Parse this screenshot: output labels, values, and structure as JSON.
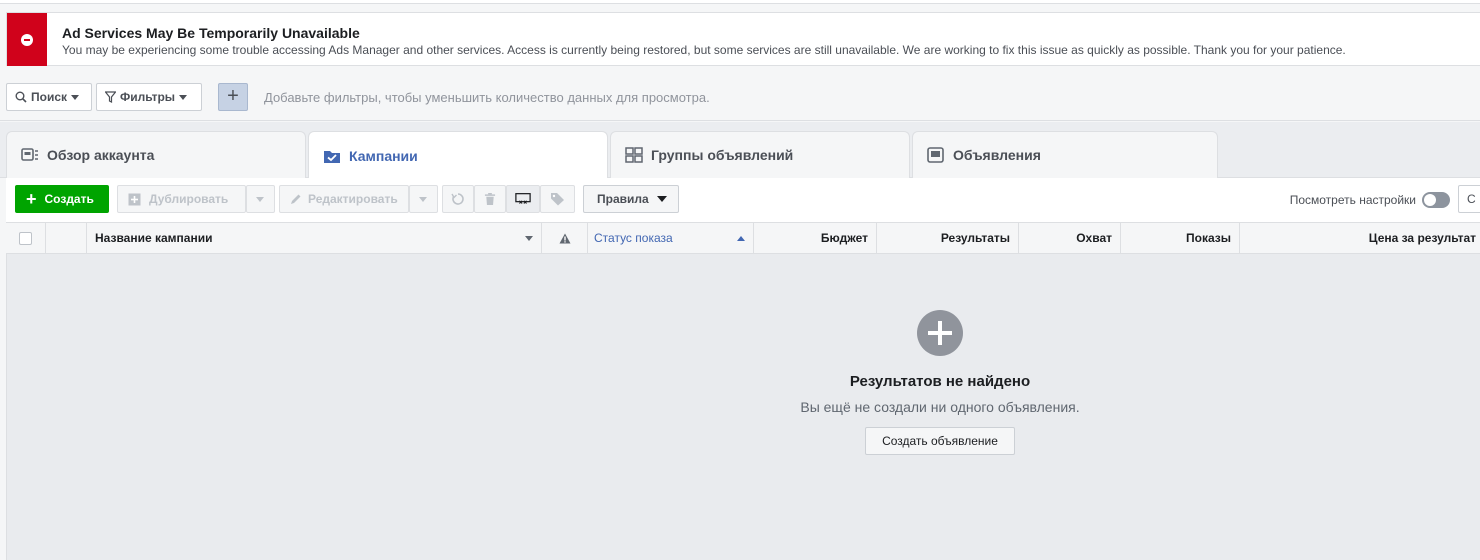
{
  "alert": {
    "title": "Ad Services May Be Temporarily Unavailable",
    "message": "You may be experiencing some trouble accessing Ads Manager and other services. Access is currently being restored, but some services are still unavailable. We are working to fix this issue as quickly as possible. Thank you for your patience.",
    "accent": "#d0021b"
  },
  "filters": {
    "search_label": "Поиск",
    "filters_label": "Фильтры",
    "add_label": "+",
    "hint": "Добавьте фильтры, чтобы уменьшить количество данных для просмотра."
  },
  "tabs": [
    {
      "label": "Обзор аккаунта",
      "icon": "account-overview-icon",
      "active": false
    },
    {
      "label": "Кампании",
      "icon": "folder-check-icon",
      "active": true
    },
    {
      "label": "Группы объявлений",
      "icon": "grid-icon",
      "active": false
    },
    {
      "label": "Объявления",
      "icon": "ad-icon",
      "active": false
    }
  ],
  "toolbar": {
    "create_label": "Создать",
    "duplicate_label": "Дублировать",
    "edit_label": "Редактировать",
    "rules_label": "Правила",
    "view_settings_label": "Посмотреть настройки",
    "extra_label": "С",
    "create_color": "#00a400"
  },
  "table": {
    "columns": [
      "Название кампании",
      "Статус показа",
      "Бюджет",
      "Результаты",
      "Охват",
      "Показы",
      "Цена за результат"
    ],
    "sort_color": "#4267b2"
  },
  "empty": {
    "title": "Результатов не найдено",
    "subtitle": "Вы ещё не создали ни одного объявления.",
    "button_label": "Создать объявление"
  }
}
